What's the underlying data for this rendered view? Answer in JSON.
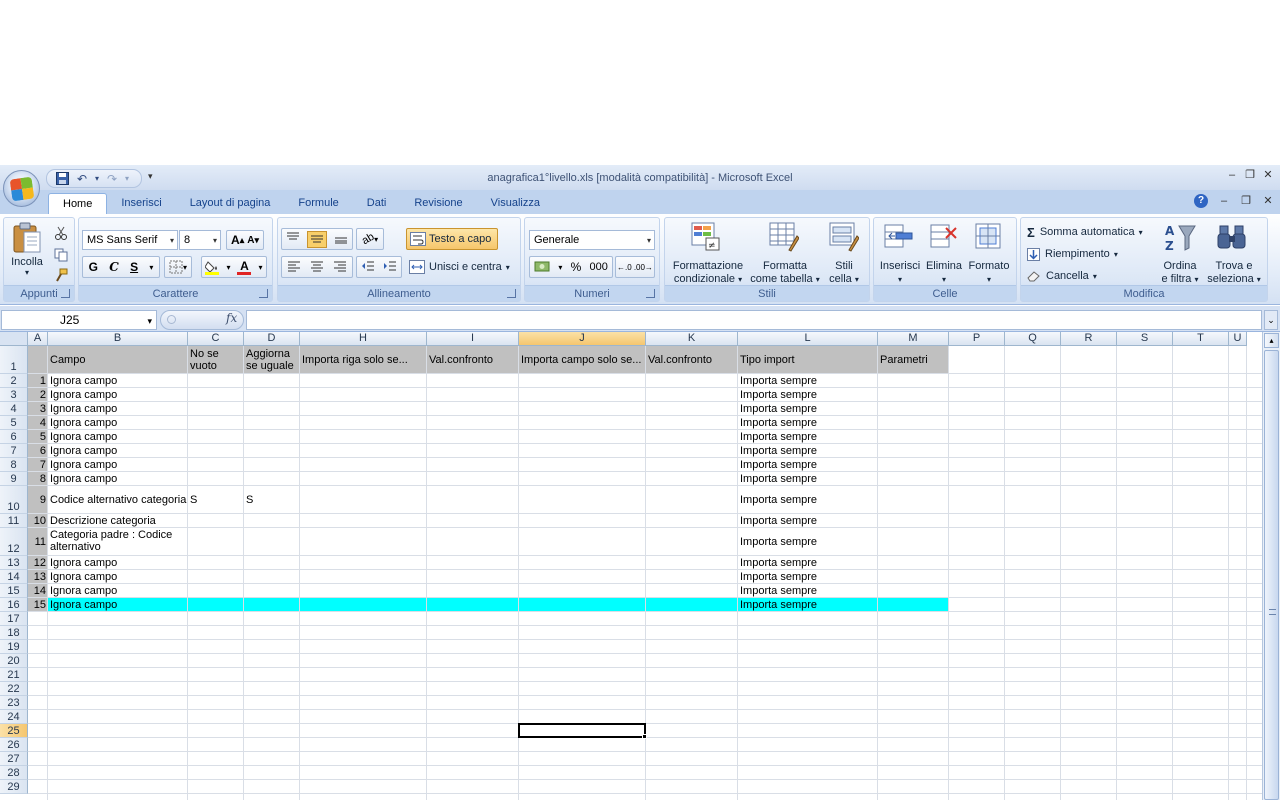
{
  "window": {
    "title": "anagrafica1°livello.xls  [modalità compatibilità] - Microsoft Excel"
  },
  "tabs": [
    "Home",
    "Inserisci",
    "Layout di pagina",
    "Formule",
    "Dati",
    "Revisione",
    "Visualizza"
  ],
  "active_tab": "Home",
  "ribbon": {
    "appunti": {
      "paste_label": "Incolla",
      "group_label": "Appunti"
    },
    "carattere": {
      "font_name": "MS Sans Serif",
      "font_size": "8",
      "bold": "G",
      "italic": "C",
      "underline": "S",
      "group_label": "Carattere"
    },
    "allineamento": {
      "wrap_text": "Testo a capo",
      "merge_center": "Unisci e centra",
      "group_label": "Allineamento"
    },
    "numeri": {
      "format": "Generale",
      "percent": "%",
      "thousands": "000",
      "group_label": "Numeri"
    },
    "stili": {
      "cond_format_1": "Formattazione",
      "cond_format_2": "condizionale",
      "table_format_1": "Formatta",
      "table_format_2": "come tabella",
      "cell_styles_1": "Stili",
      "cell_styles_2": "cella",
      "group_label": "Stili"
    },
    "celle": {
      "insert": "Inserisci",
      "delete": "Elimina",
      "format": "Formato",
      "group_label": "Celle"
    },
    "modifica": {
      "autosum": "Somma automatica",
      "fill": "Riempimento",
      "clear": "Cancella",
      "sort_1": "Ordina",
      "sort_2": "e filtra",
      "find_1": "Trova e",
      "find_2": "seleziona",
      "group_label": "Modifica"
    }
  },
  "formula_bar": {
    "name_box": "J25",
    "fx": "fx",
    "formula": ""
  },
  "sheet": {
    "columns": [
      "A",
      "B",
      "C",
      "D",
      "H",
      "I",
      "J",
      "K",
      "L",
      "M",
      "P",
      "Q",
      "R",
      "S",
      "T",
      "U"
    ],
    "selected_column": "J",
    "selected_row": "25",
    "headers": {
      "campo": "Campo",
      "no_se_vuoto": "No se vuoto",
      "aggiorna": "Aggiorna se uguale",
      "importa_riga": "Importa riga solo se...",
      "val_confronto_1": "Val.confronto",
      "importa_campo": "Importa campo solo se...",
      "val_confronto_2": "Val.confronto",
      "tipo_import": "Tipo import",
      "parametri": "Parametri"
    },
    "rows": [
      {
        "n": "1",
        "campo": "Ignora campo",
        "c": "",
        "d": "",
        "tipo": "Importa sempre"
      },
      {
        "n": "2",
        "campo": "Ignora campo",
        "c": "",
        "d": "",
        "tipo": "Importa sempre"
      },
      {
        "n": "3",
        "campo": "Ignora campo",
        "c": "",
        "d": "",
        "tipo": "Importa sempre"
      },
      {
        "n": "4",
        "campo": "Ignora campo",
        "c": "",
        "d": "",
        "tipo": "Importa sempre"
      },
      {
        "n": "5",
        "campo": "Ignora campo",
        "c": "",
        "d": "",
        "tipo": "Importa sempre"
      },
      {
        "n": "6",
        "campo": "Ignora campo",
        "c": "",
        "d": "",
        "tipo": "Importa sempre"
      },
      {
        "n": "7",
        "campo": "Ignora campo",
        "c": "",
        "d": "",
        "tipo": "Importa sempre"
      },
      {
        "n": "8",
        "campo": "Ignora campo",
        "c": "",
        "d": "",
        "tipo": "Importa sempre"
      },
      {
        "n": "9",
        "campo": "Codice alternativo categoria",
        "c": "S",
        "d": "S",
        "tipo": "Importa sempre"
      },
      {
        "n": "10",
        "campo": "Descrizione categoria",
        "c": "",
        "d": "",
        "tipo": "Importa sempre"
      },
      {
        "n": "11",
        "campo": "Categoria padre : Codice alternativo",
        "c": "",
        "d": "",
        "tipo": "Importa sempre"
      },
      {
        "n": "12",
        "campo": "Ignora campo",
        "c": "",
        "d": "",
        "tipo": "Importa sempre"
      },
      {
        "n": "13",
        "campo": "Ignora campo",
        "c": "",
        "d": "",
        "tipo": "Importa sempre"
      },
      {
        "n": "14",
        "campo": "Ignora campo",
        "c": "",
        "d": "",
        "tipo": "Importa sempre"
      },
      {
        "n": "15",
        "campo": "Ignora campo",
        "c": "",
        "d": "",
        "tipo": "Importa sempre"
      }
    ],
    "highlight_color": "#00ffff",
    "row_numbers": [
      "1",
      "2",
      "3",
      "4",
      "5",
      "6",
      "7",
      "8",
      "9",
      "10",
      "11",
      "12",
      "13",
      "14",
      "15",
      "16",
      "17",
      "18",
      "19",
      "20",
      "21",
      "22",
      "23",
      "24",
      "25",
      "26",
      "27",
      "28",
      "29"
    ]
  }
}
